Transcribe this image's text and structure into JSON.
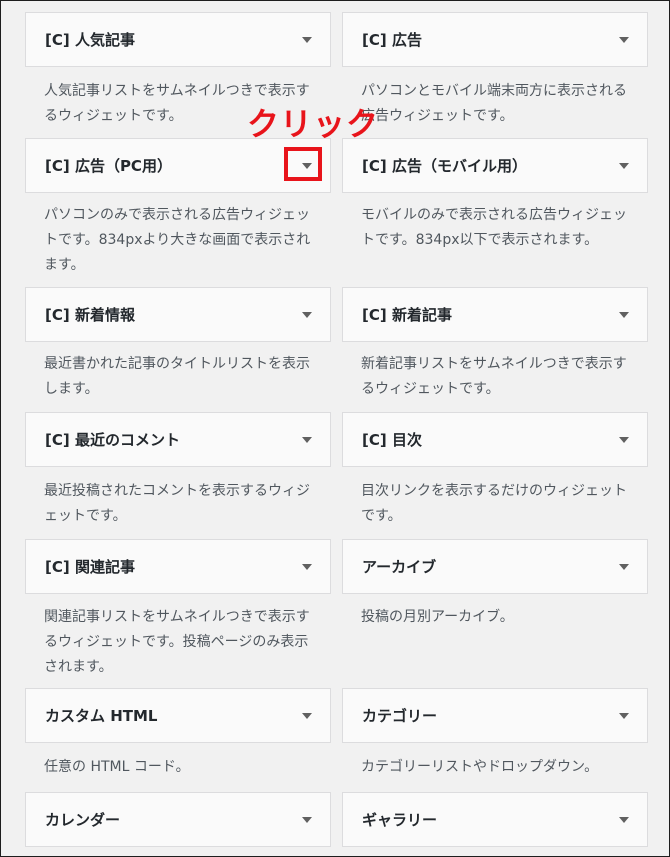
{
  "widgets": [
    {
      "title": "[C] 人気記事",
      "desc": "人気記事リストをサムネイルつきで表示するウィジェットです。"
    },
    {
      "title": "[C] 広告",
      "desc": "パソコンとモバイル端末両方に表示される広告ウィジェットです。"
    },
    {
      "title": "[C] 広告（PC用）",
      "desc": "パソコンのみで表示される広告ウィジェットです。834pxより大きな画面で表示されます。"
    },
    {
      "title": "[C] 広告（モバイル用）",
      "desc": "モバイルのみで表示される広告ウィジェットです。834px以下で表示されます。"
    },
    {
      "title": "[C] 新着情報",
      "desc": "最近書かれた記事のタイトルリストを表示します。"
    },
    {
      "title": "[C] 新着記事",
      "desc": "新着記事リストをサムネイルつきで表示するウィジェットです。"
    },
    {
      "title": "[C] 最近のコメント",
      "desc": "最近投稿されたコメントを表示するウィジェットです。"
    },
    {
      "title": "[C] 目次",
      "desc": "目次リンクを表示するだけのウィジェットです。"
    },
    {
      "title": "[C] 関連記事",
      "desc": "関連記事リストをサムネイルつきで表示するウィジェットです。投稿ページのみ表示されます。"
    },
    {
      "title": "アーカイブ",
      "desc": "投稿の月別アーカイブ。"
    },
    {
      "title": "カスタム HTML",
      "desc": "任意の HTML コード。"
    },
    {
      "title": "カテゴリー",
      "desc": "カテゴリーリストやドロップダウン。"
    },
    {
      "title": "カレンダー",
      "desc": ""
    },
    {
      "title": "ギャラリー",
      "desc": ""
    }
  ],
  "annotation": {
    "text": "クリック",
    "color": "#e8141b"
  }
}
